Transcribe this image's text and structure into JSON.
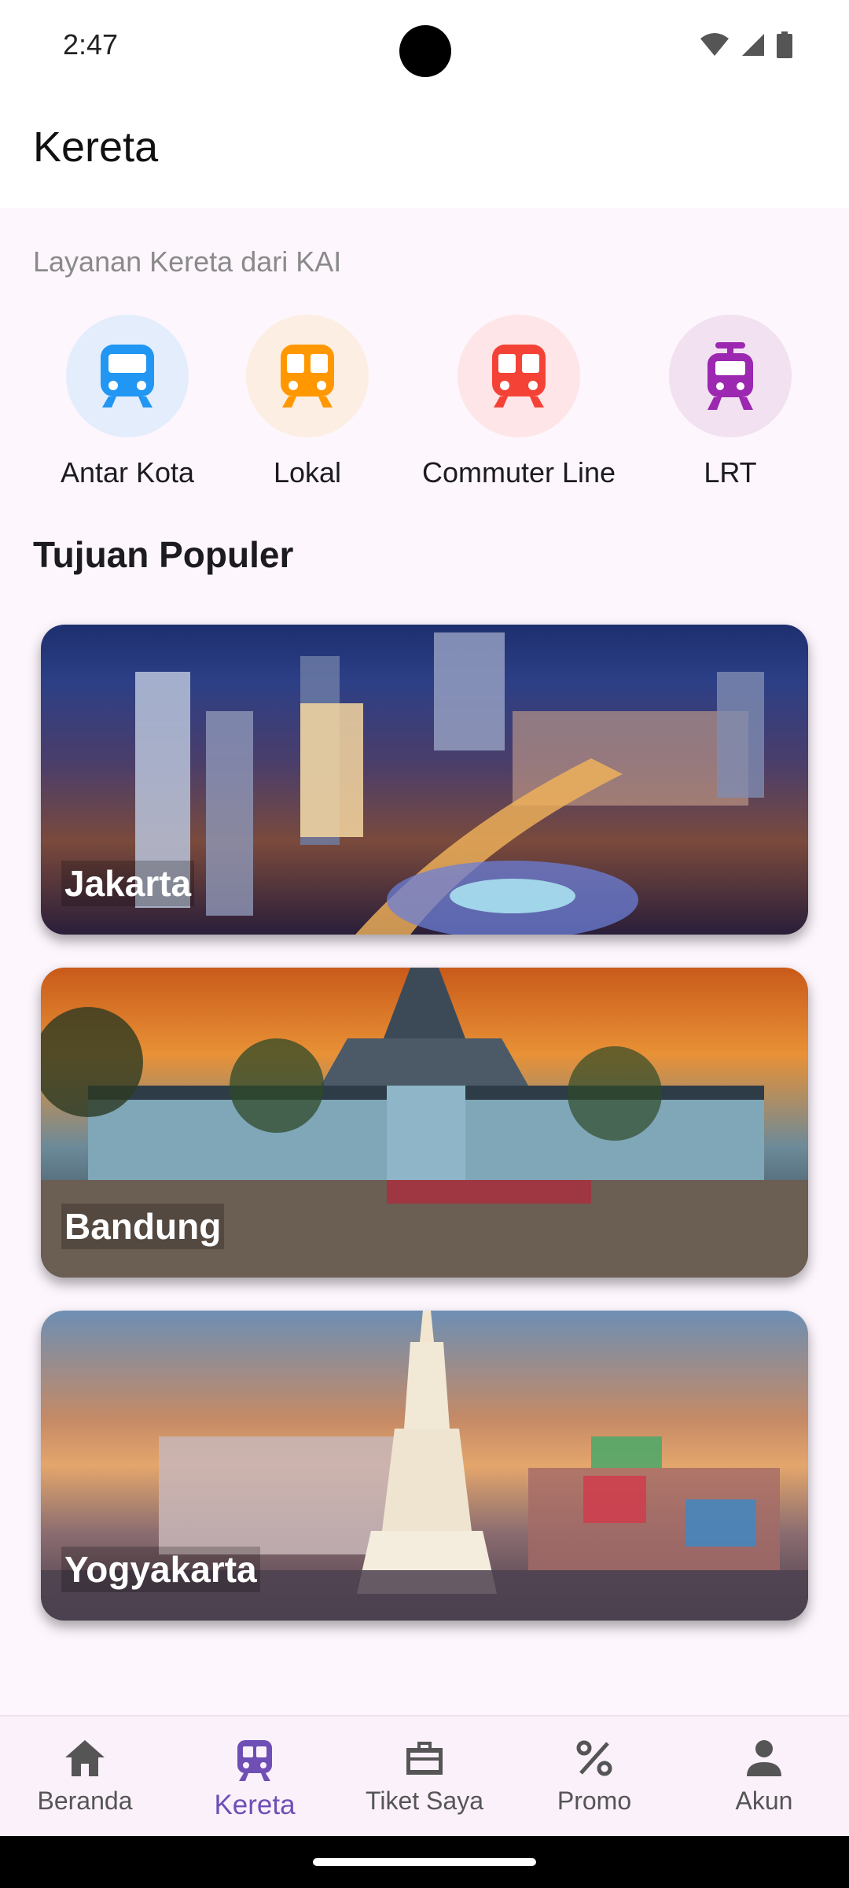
{
  "status_bar": {
    "time": "2:47"
  },
  "app_bar": {
    "title": "Kereta"
  },
  "services": {
    "label": "Layanan Kereta dari KAI",
    "items": [
      {
        "label": "Antar Kota",
        "icon": "train-front-icon",
        "color": "#2196f3",
        "bg": "#e3edfc"
      },
      {
        "label": "Lokal",
        "icon": "train-front-icon",
        "color": "#ff9800",
        "bg": "#fdeee3"
      },
      {
        "label": "Commuter Line",
        "icon": "train-front-icon",
        "color": "#f44336",
        "bg": "#fde5e8"
      },
      {
        "label": "LRT",
        "icon": "tram-icon",
        "color": "#9c27b0",
        "bg": "#f1e1f1"
      }
    ]
  },
  "popular": {
    "title": "Tujuan Populer",
    "destinations": [
      {
        "name": "Jakarta"
      },
      {
        "name": "Bandung"
      },
      {
        "name": "Yogyakarta"
      }
    ]
  },
  "bottom_nav": {
    "items": [
      {
        "label": "Beranda",
        "icon": "home-icon",
        "active": false
      },
      {
        "label": "Kereta",
        "icon": "train-icon",
        "active": true
      },
      {
        "label": "Tiket Saya",
        "icon": "briefcase-icon",
        "active": false
      },
      {
        "label": "Promo",
        "icon": "percent-icon",
        "active": false
      },
      {
        "label": "Akun",
        "icon": "person-icon",
        "active": false
      }
    ],
    "active_color": "#6f4fb5"
  }
}
